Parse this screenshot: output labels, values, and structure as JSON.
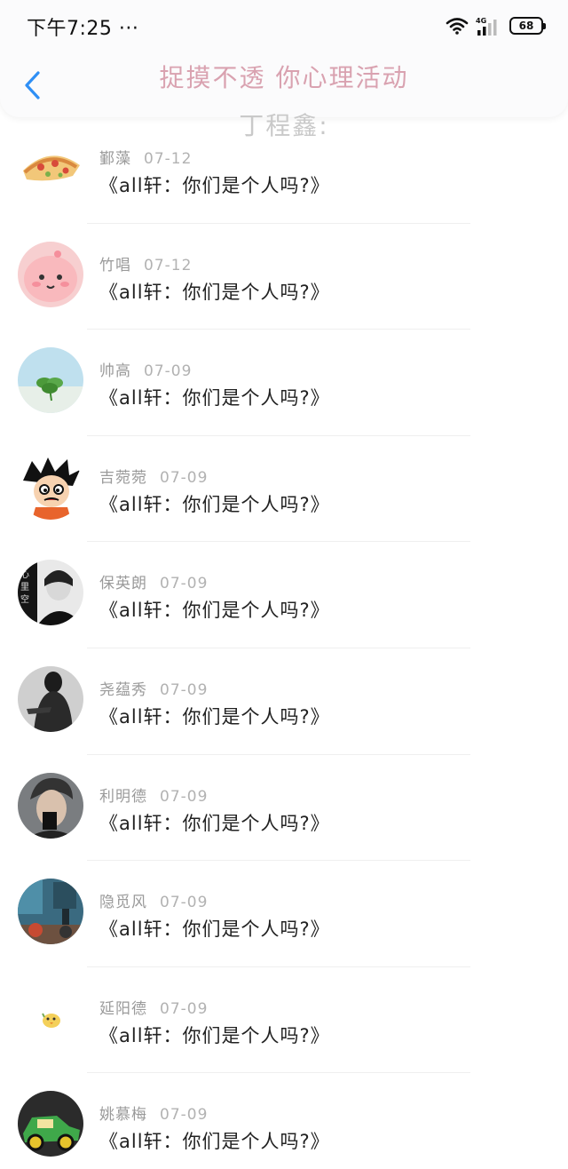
{
  "status_bar": {
    "time": "下午7:25",
    "dots": "···",
    "network": "4G",
    "battery": "68"
  },
  "header": {
    "title": "捉摸不透 你心理活动",
    "subtitle": "丁程鑫:"
  },
  "items": [
    {
      "name": "鄞藻",
      "date": "07-12",
      "text": "《all轩：你们是个人吗?》",
      "avatar": "pizza"
    },
    {
      "name": "竹唱",
      "date": "07-12",
      "text": "《all轩：你们是个人吗?》",
      "avatar": "pink-blob"
    },
    {
      "name": "帅高",
      "date": "07-09",
      "text": "《all轩：你们是个人吗?》",
      "avatar": "clover"
    },
    {
      "name": "吉菀菀",
      "date": "07-09",
      "text": "《all轩：你们是个人吗?》",
      "avatar": "cartoon-boy"
    },
    {
      "name": "保英朗",
      "date": "07-09",
      "text": "《all轩：你们是个人吗?》",
      "avatar": "portrait-bw"
    },
    {
      "name": "尧蕴秀",
      "date": "07-09",
      "text": "《all轩：你们是个人吗?》",
      "avatar": "dark-figure"
    },
    {
      "name": "利明德",
      "date": "07-09",
      "text": "《all轩：你们是个人吗?》",
      "avatar": "man-portrait"
    },
    {
      "name": "隐觅风",
      "date": "07-09",
      "text": "《all轩：你们是个人吗?》",
      "avatar": "street-scene"
    },
    {
      "name": "延阳德",
      "date": "07-09",
      "text": "《all轩：你们是个人吗?》",
      "avatar": "small-chick"
    },
    {
      "name": "姚慕梅",
      "date": "07-09",
      "text": "《all轩：你们是个人吗?》",
      "avatar": "green-toy-car"
    }
  ],
  "colors": {
    "accent": "#2f8ff5",
    "title": "#d9a2b0",
    "subtitle": "#c9c9c9"
  }
}
